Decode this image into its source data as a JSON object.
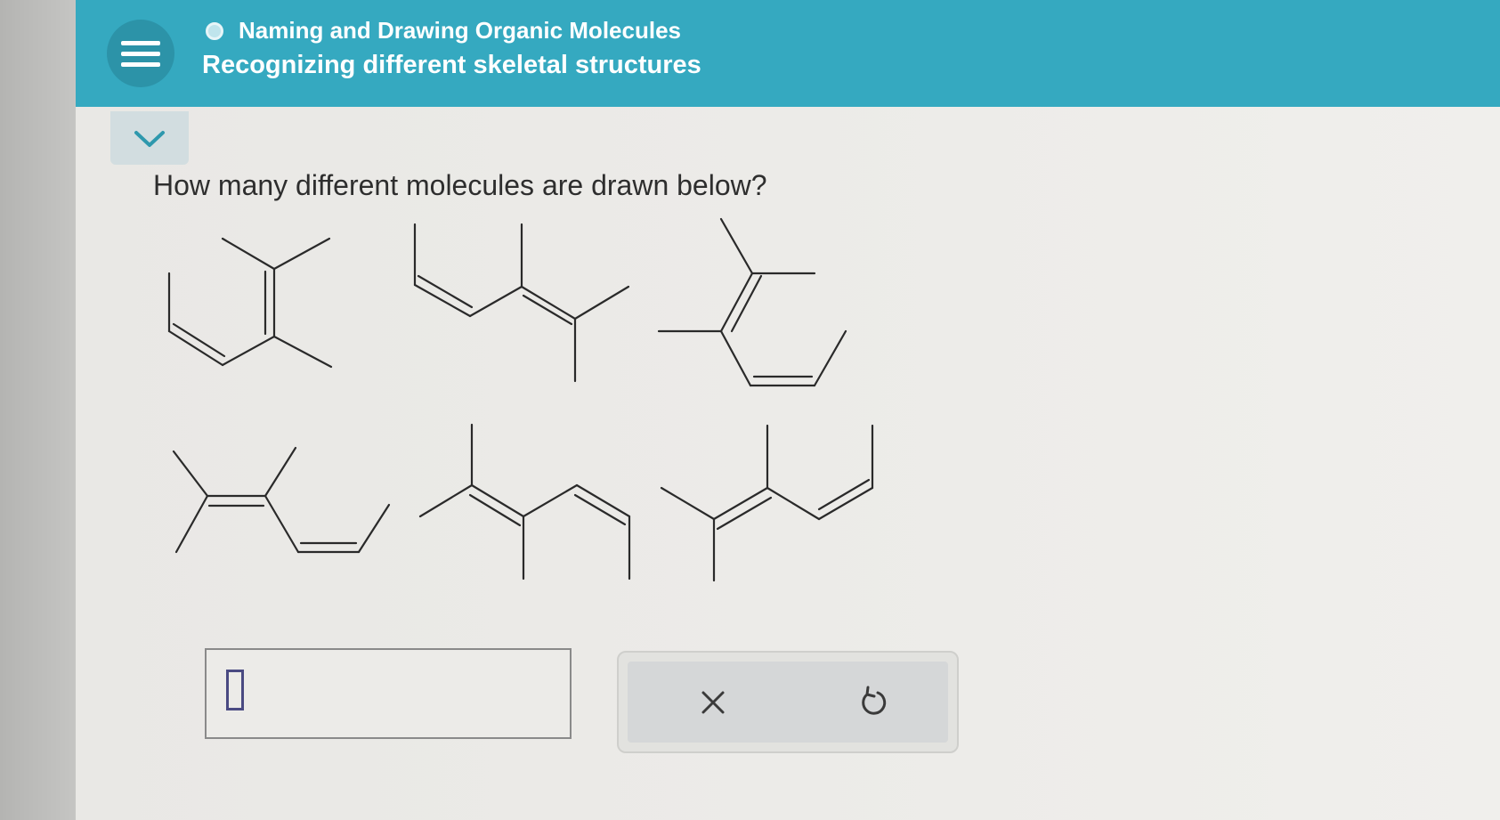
{
  "header": {
    "subject": "Naming and Drawing Organic Molecules",
    "topic": "Recognizing different skeletal structures"
  },
  "question": {
    "text": "How many different molecules are drawn below?"
  },
  "answer": {
    "value": ""
  },
  "actions": {
    "clear_icon": "x-icon",
    "undo_icon": "undo-icon"
  },
  "colors": {
    "header": "#35a9c0",
    "menu_button": "#2c93a8",
    "background": "#ecebe8",
    "text": "#2e2e2e"
  }
}
